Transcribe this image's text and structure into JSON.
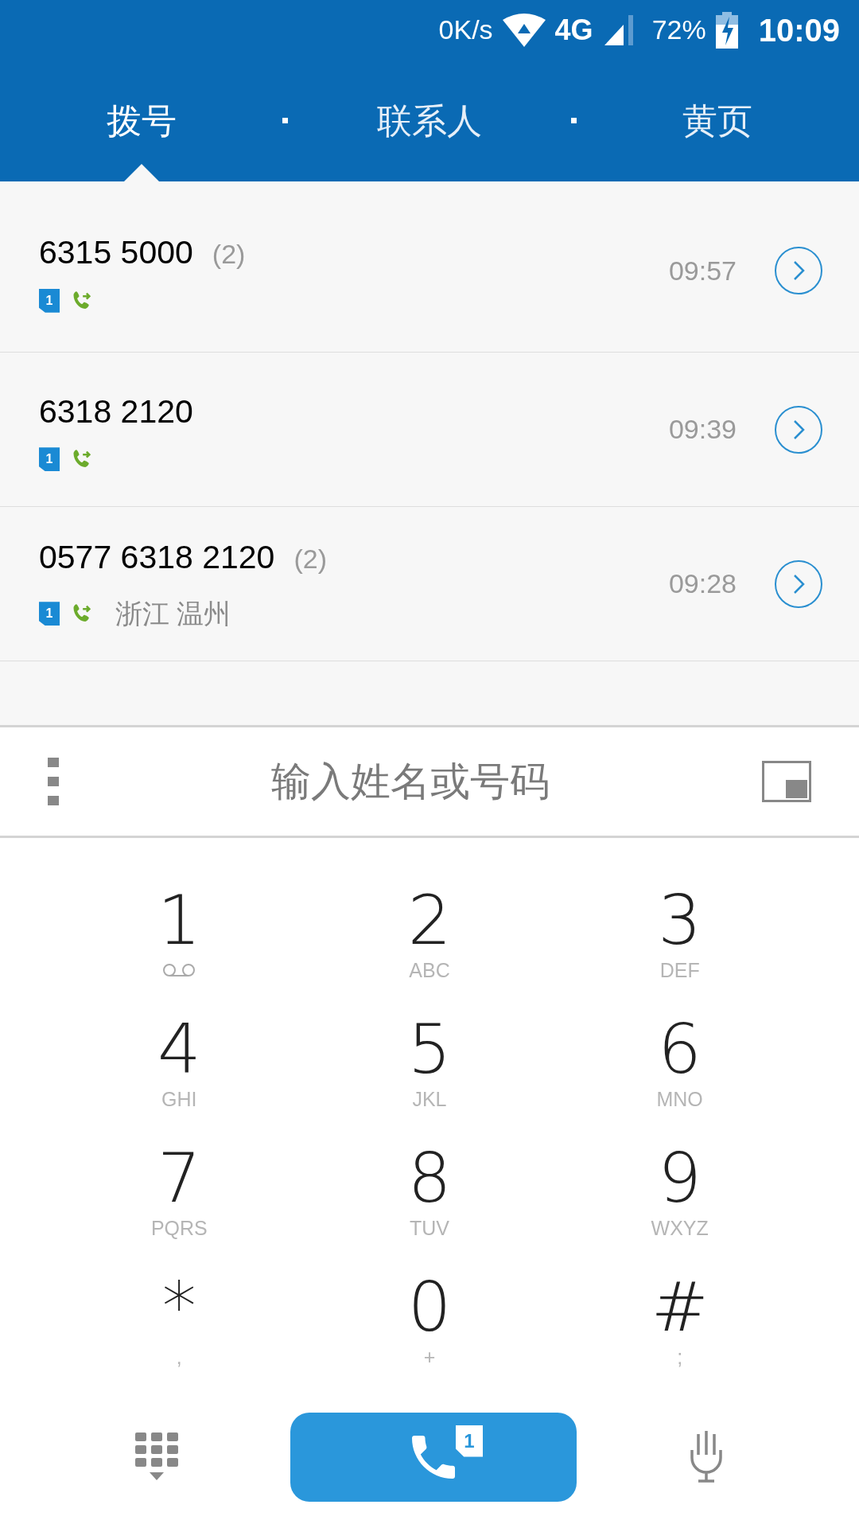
{
  "status_bar": {
    "speed": "0K/s",
    "network": "4G",
    "battery": "72%",
    "time": "10:09"
  },
  "tabs": [
    {
      "label": "拨号",
      "selected": true
    },
    {
      "label": "联系人",
      "selected": false
    },
    {
      "label": "黄页",
      "selected": false
    }
  ],
  "calls": [
    {
      "number": "6315 5000",
      "count": "(2)",
      "sim": "1",
      "time": "09:57"
    },
    {
      "number": "6318 2120",
      "sim": "1",
      "time": "09:39"
    },
    {
      "number": "0577 6318 2120",
      "count": "(2)",
      "sim": "1",
      "location": "浙江 温州",
      "time": "09:28"
    }
  ],
  "search": {
    "placeholder": "输入姓名或号码"
  },
  "keys": [
    {
      "digit": "1",
      "kind": "voicemail"
    },
    {
      "digit": "2",
      "letters": "ABC",
      "kind": "letters"
    },
    {
      "digit": "3",
      "letters": "DEF",
      "kind": "letters"
    },
    {
      "digit": "4",
      "letters": "GHI",
      "kind": "letters"
    },
    {
      "digit": "5",
      "letters": "JKL",
      "kind": "letters"
    },
    {
      "digit": "6",
      "letters": "MNO",
      "kind": "letters"
    },
    {
      "digit": "7",
      "letters": "PQRS",
      "kind": "letters"
    },
    {
      "digit": "8",
      "letters": "TUV",
      "kind": "letters"
    },
    {
      "digit": "9",
      "letters": "WXYZ",
      "kind": "letters"
    },
    {
      "digit": "*",
      "letters": ",",
      "kind": "letters"
    },
    {
      "digit": "0",
      "letters": "+",
      "kind": "letters"
    },
    {
      "digit": "#",
      "letters": ";",
      "kind": "letters"
    }
  ],
  "call_button": {
    "sim": "1"
  }
}
